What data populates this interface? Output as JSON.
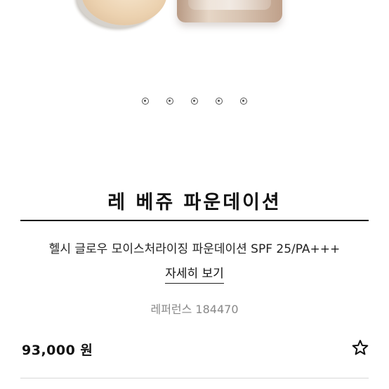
{
  "carousel": {
    "dot_count": 5
  },
  "product": {
    "name": "레 베쥬 파운데이션",
    "description": "헬시 글로우 모이스처라이징 파운데이션 SPF 25/PA+++",
    "details_link": "자세히 보기",
    "reference": "레퍼런스 184470",
    "price": "93,000 원"
  },
  "icons": {
    "wishlist": "star-outline-icon"
  },
  "colors": {
    "text": "#111111",
    "muted": "#888888"
  }
}
